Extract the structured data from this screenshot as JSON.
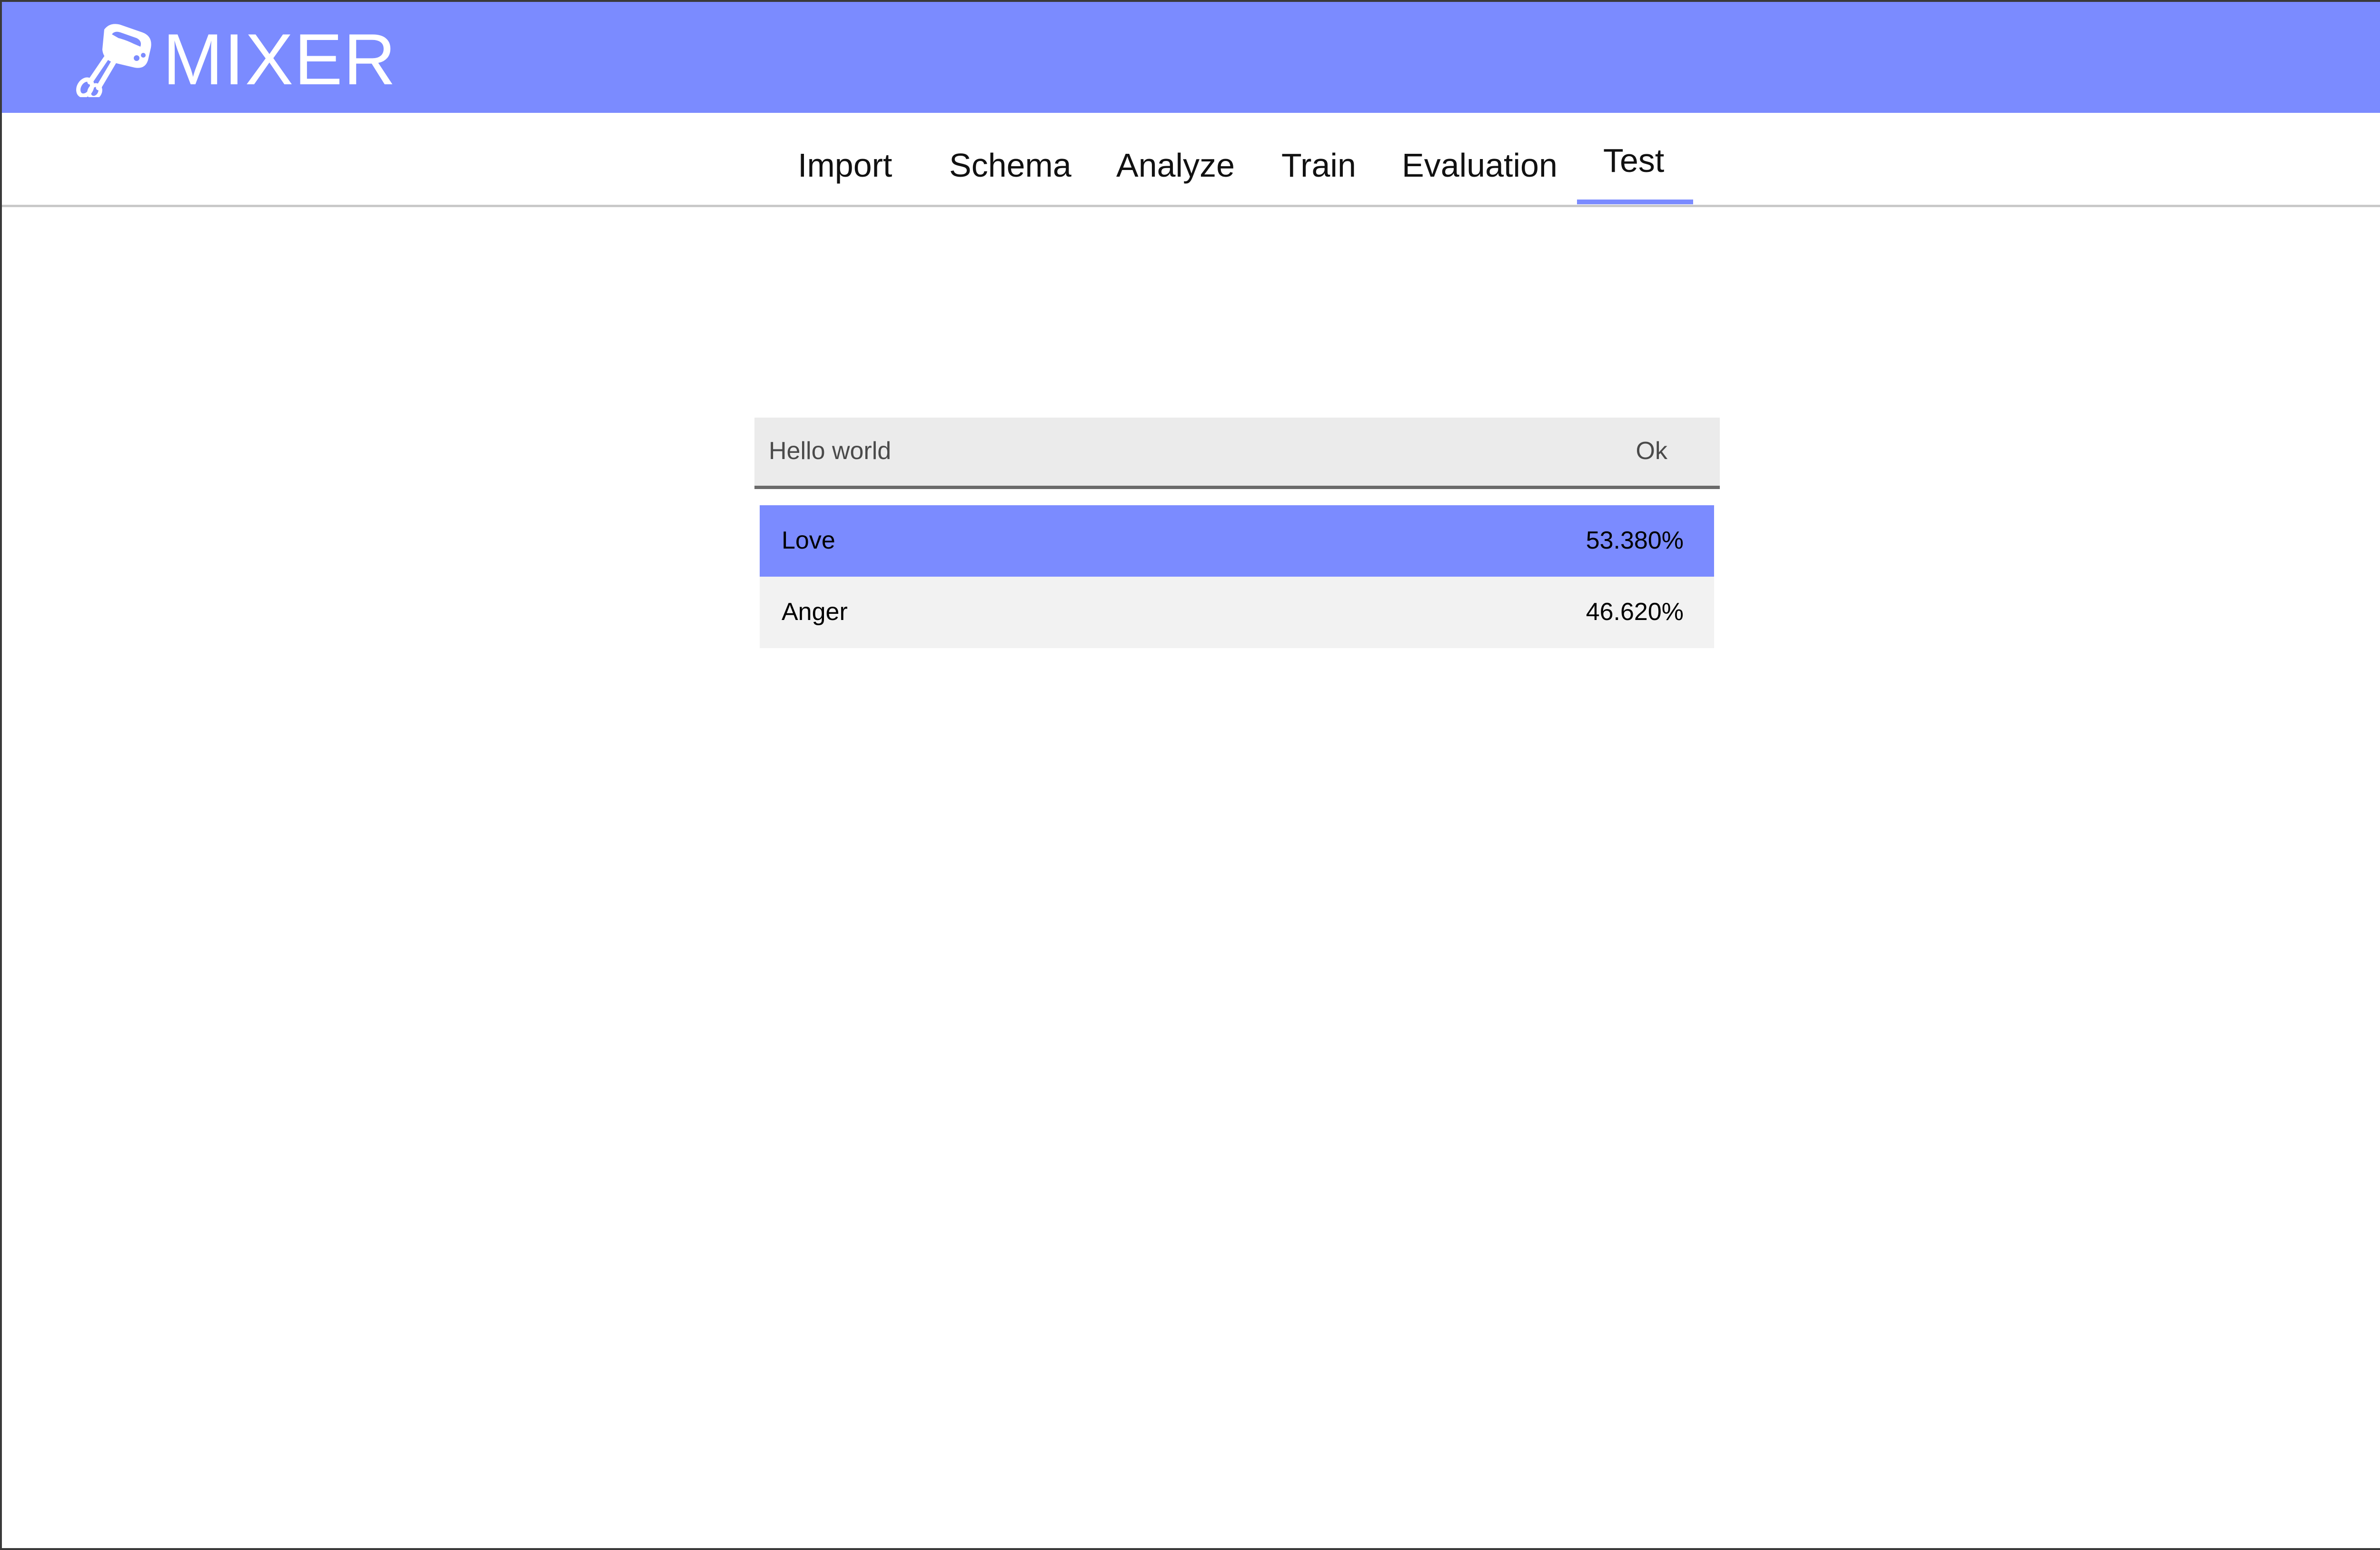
{
  "app": {
    "title": "MIXER",
    "logo_icon": "hand-mixer-icon",
    "accent_color": "#7b8bff"
  },
  "tabs": [
    {
      "label": "Import",
      "active": false
    },
    {
      "label": "Schema",
      "active": false
    },
    {
      "label": "Analyze",
      "active": false
    },
    {
      "label": "Train",
      "active": false
    },
    {
      "label": "Evaluation",
      "active": false
    },
    {
      "label": "Test",
      "active": true
    }
  ],
  "test": {
    "query_value": "Hello world",
    "ok_label": "Ok",
    "results": [
      {
        "label": "Love",
        "value": "53.380%",
        "highlighted": true
      },
      {
        "label": "Anger",
        "value": "46.620%",
        "highlighted": false
      }
    ]
  }
}
